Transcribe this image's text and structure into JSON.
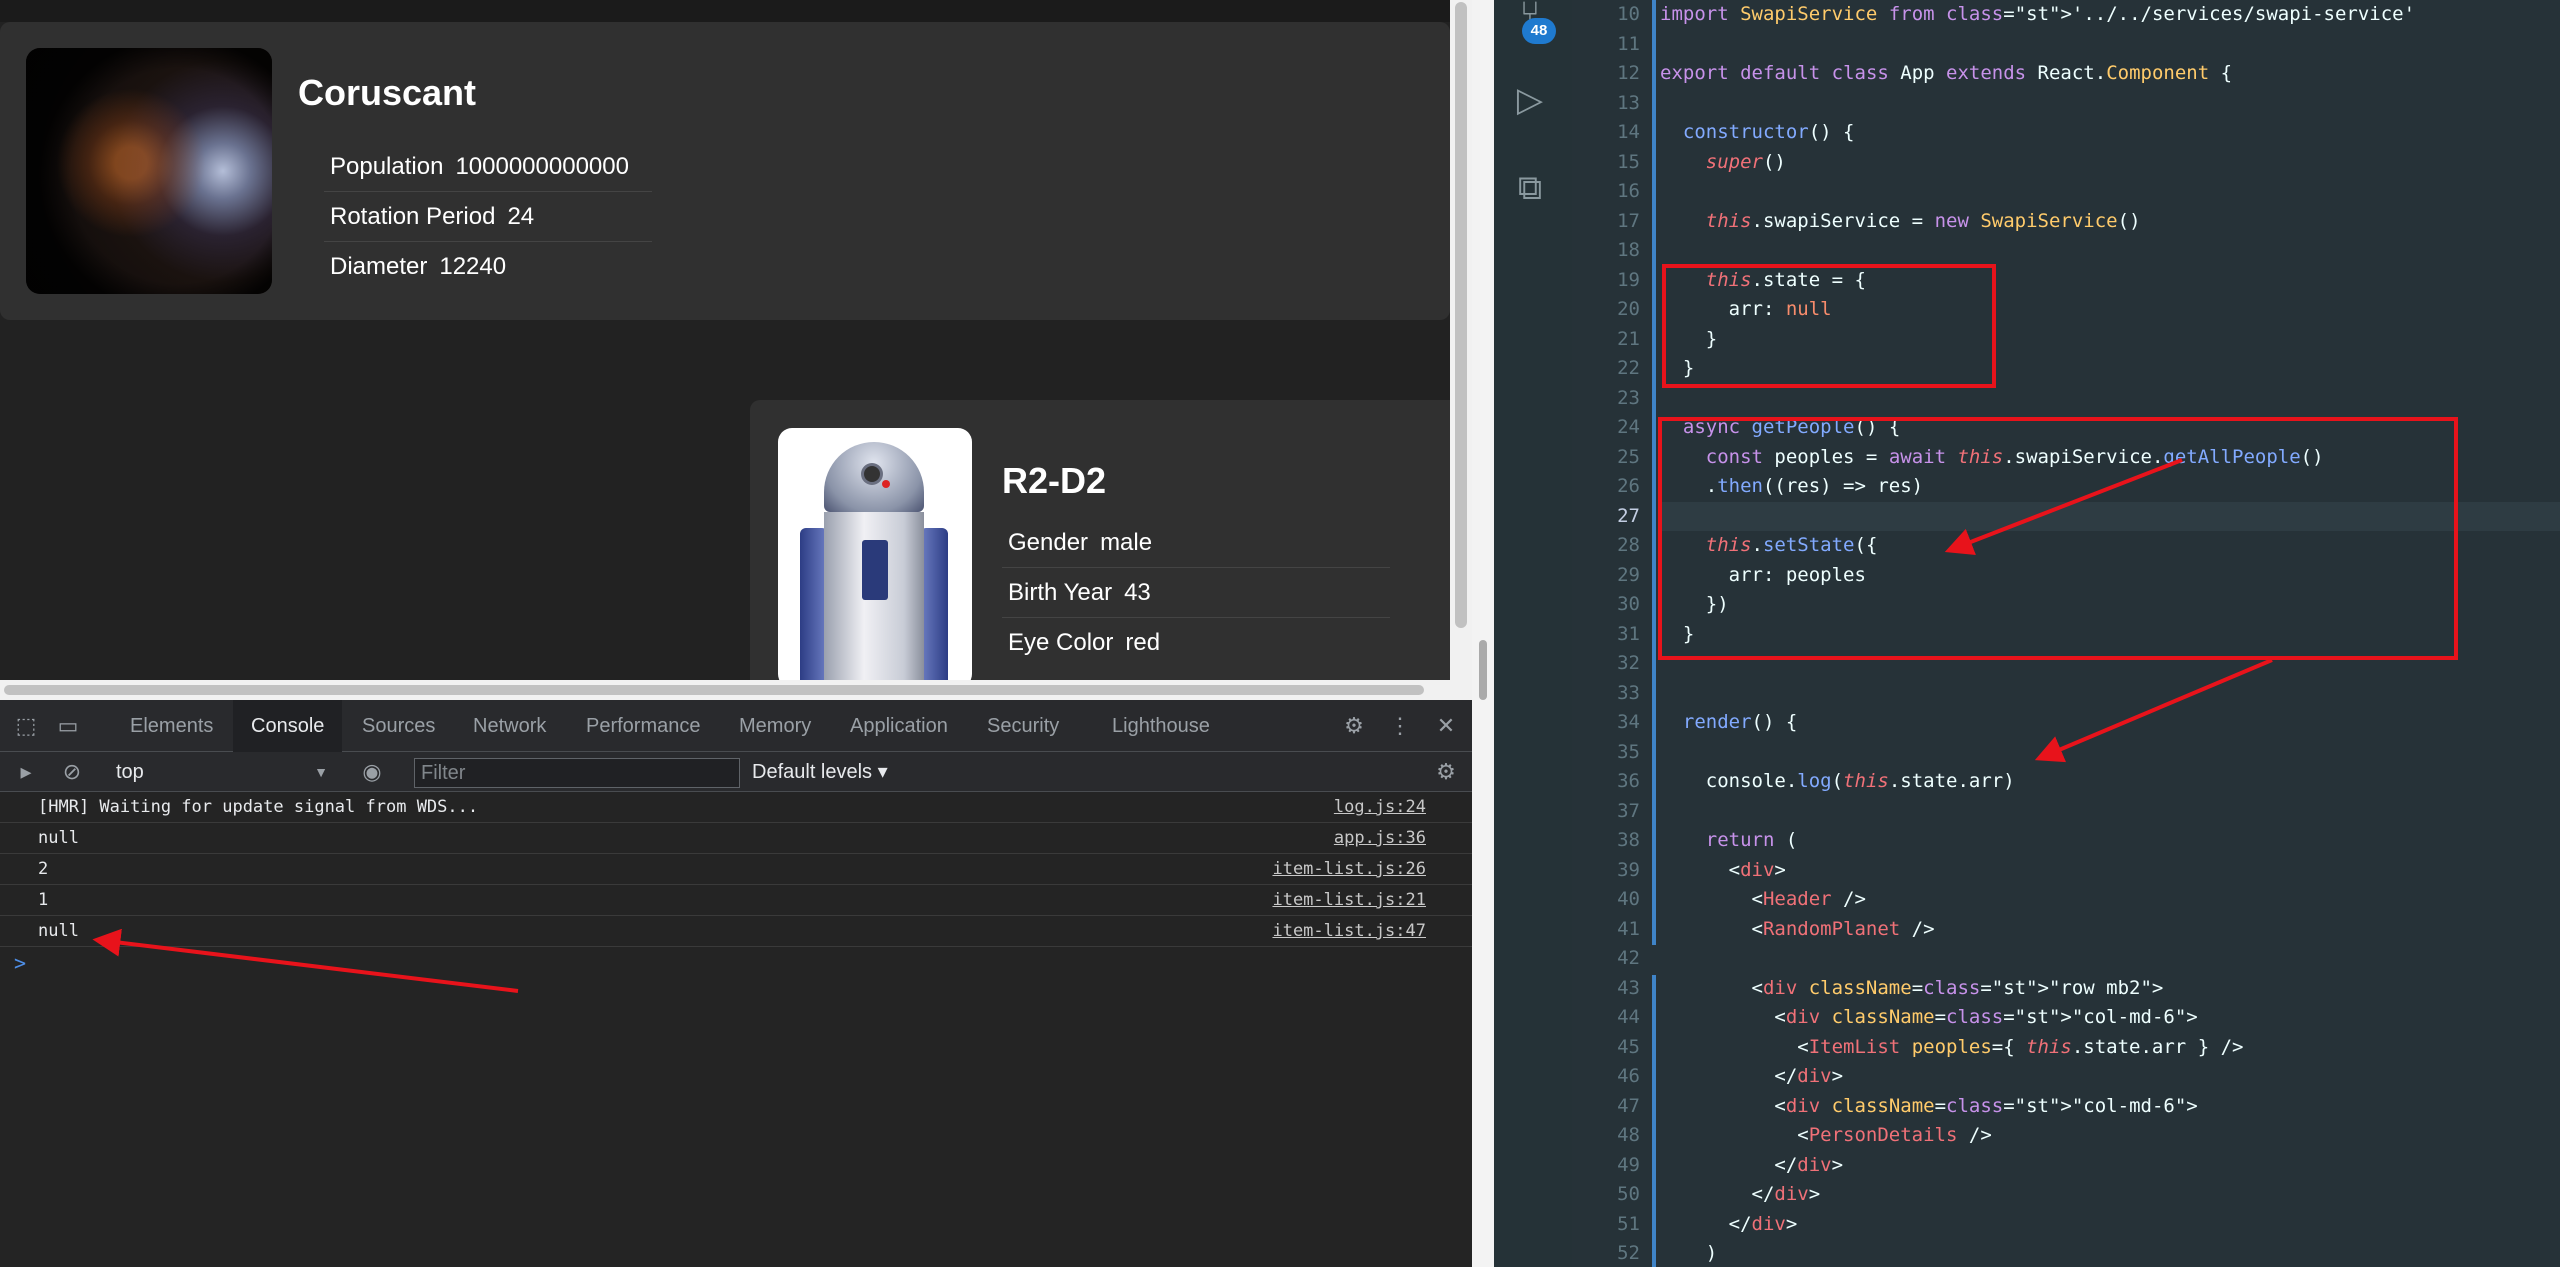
{
  "planet": {
    "name": "Coruscant",
    "props": [
      {
        "label": "Population",
        "value": "1000000000000"
      },
      {
        "label": "Rotation Period",
        "value": "24"
      },
      {
        "label": "Diameter",
        "value": "12240"
      }
    ]
  },
  "person": {
    "name": "R2-D2",
    "props": [
      {
        "label": "Gender",
        "value": "male"
      },
      {
        "label": "Birth Year",
        "value": "43"
      },
      {
        "label": "Eye Color",
        "value": "red"
      }
    ]
  },
  "devtools": {
    "tabs": [
      "Elements",
      "Console",
      "Sources",
      "Network",
      "Performance",
      "Memory",
      "Application",
      "Security",
      "Lighthouse"
    ],
    "context": "top",
    "filter_placeholder": "Filter",
    "levels": "Default levels ▾",
    "console": [
      {
        "msg": "[HMR] Waiting for update signal from WDS...",
        "src": "log.js:24"
      },
      {
        "msg": "null",
        "src": "app.js:36"
      },
      {
        "msg": "2",
        "src": "item-list.js:26"
      },
      {
        "msg": "1",
        "src": "item-list.js:21"
      },
      {
        "msg": "null",
        "src": "item-list.js:47"
      }
    ],
    "prompt": ">"
  },
  "activity": {
    "badge": "48"
  },
  "editor": {
    "line_start": 10,
    "current_line": 27,
    "lines": [
      "import SwapiService from '../../services/swapi-service'",
      "",
      "export default class App extends React.Component {",
      "",
      "  constructor() {",
      "    super()",
      "",
      "    this.swapiService = new SwapiService()",
      "",
      "    this.state = {",
      "      arr: null",
      "    }",
      "  }",
      "",
      "  async getPeople() {",
      "    const peoples = await this.swapiService.getAllPeople()",
      "    .then((res) => res)",
      "",
      "    this.setState({",
      "      arr: peoples",
      "    })",
      "  }",
      "",
      "",
      "  render() {",
      "",
      "    console.log(this.state.arr)",
      "",
      "    return (",
      "      <div>",
      "        <Header />",
      "        <RandomPlanet />",
      "",
      "        <div className=\"row mb2\">",
      "          <div className=\"col-md-6\">",
      "            <ItemList peoples={ this.state.arr } />",
      "          </div>",
      "          <div className=\"col-md-6\">",
      "            <PersonDetails />",
      "          </div>",
      "        </div>",
      "      </div>",
      "    )"
    ]
  },
  "colors": {
    "annotation": "#e8131b",
    "badge": "#1f7acf",
    "editor_bg": "#263238"
  }
}
